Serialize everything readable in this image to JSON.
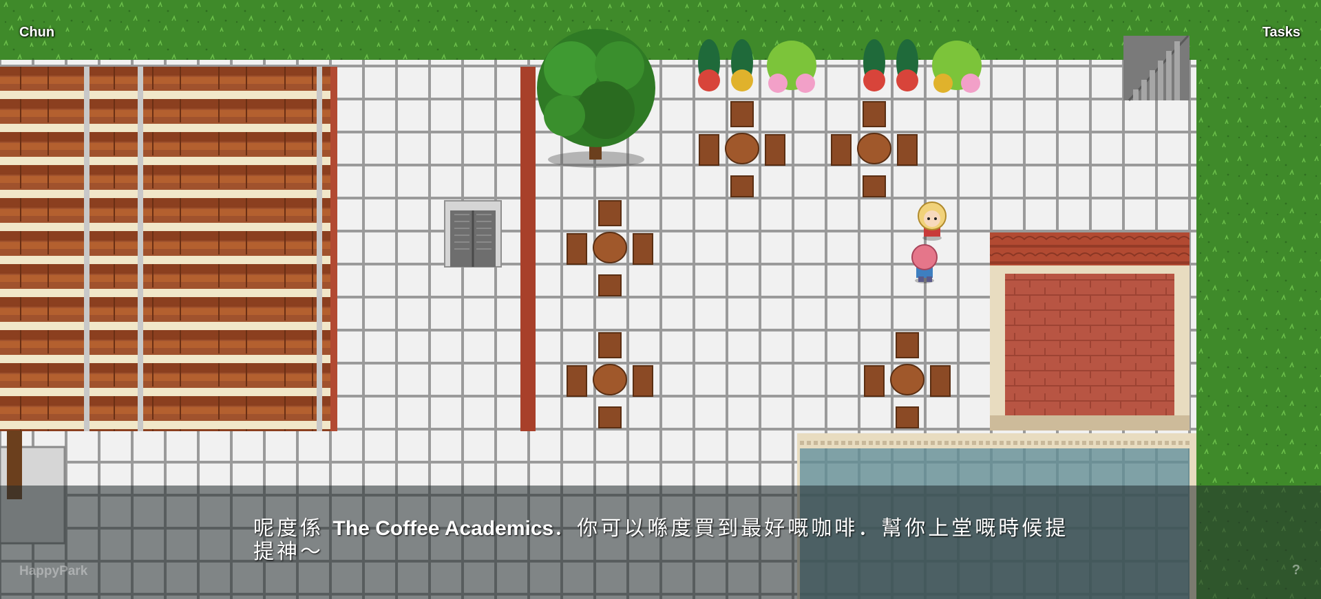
{
  "hud": {
    "player_name": "Chun",
    "tasks_label": "Tasks",
    "brand": "HappyPark",
    "help_label": "?"
  },
  "dialog": {
    "line_before": "呢度係 ",
    "place_name": "The Coffee Academics",
    "line_after": "．你可以喺度買到最好嘅咖啡．幫你上堂嘅時候提提神～"
  },
  "scene": {
    "location": "The Coffee Academics",
    "characters": [
      "blonde-npc",
      "pink-hair-player"
    ],
    "colors": {
      "grass": "#3f8a2a",
      "tile": "#ececec",
      "wood": "#a0522d",
      "roof": "#b24a32",
      "pool": "#7fa1a6"
    }
  }
}
